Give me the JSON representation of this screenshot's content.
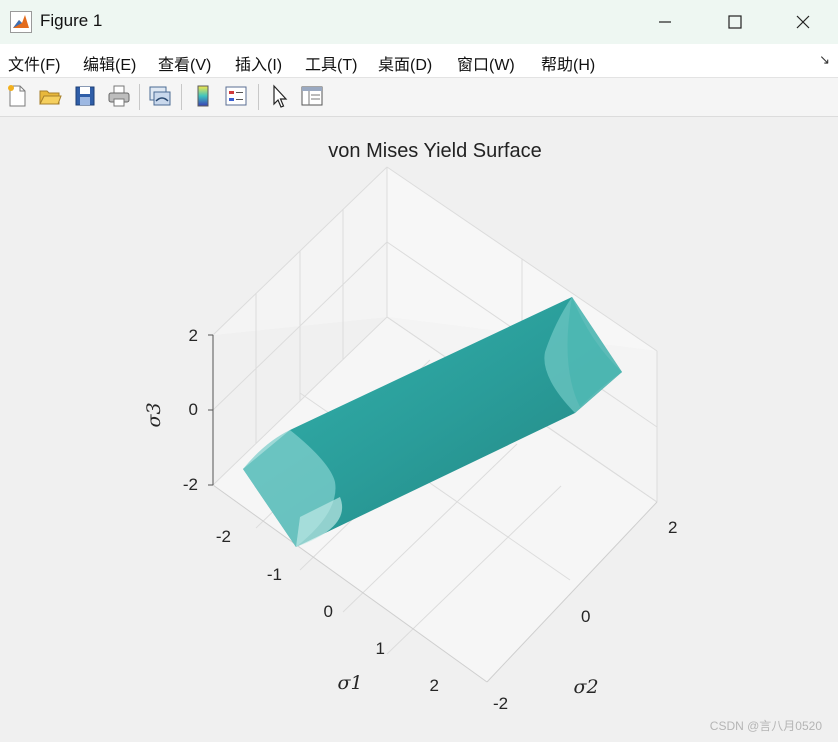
{
  "window": {
    "title": "Figure 1"
  },
  "menu": {
    "items": [
      "文件(F)",
      "编辑(E)",
      "查看(V)",
      "插入(I)",
      "工具(T)",
      "桌面(D)",
      "窗口(W)",
      "帮助(H)"
    ],
    "overflow_arrow": "↘"
  },
  "toolbar": {
    "icons": [
      "new-figure-icon",
      "open-file-icon",
      "save-icon",
      "print-icon",
      "link-plot-icon",
      "colorbar-icon",
      "legend-icon",
      "select-arrow-icon",
      "property-inspector-icon"
    ]
  },
  "chart_data": {
    "type": "surface",
    "title": "von Mises Yield Surface",
    "xlabel": "σ1",
    "ylabel": "σ2",
    "zlabel": "σ3",
    "xlim": [
      -2,
      2
    ],
    "ylim": [
      -2,
      2
    ],
    "zlim": [
      -2,
      2
    ],
    "x_ticks": [
      "-2",
      "-1",
      "0",
      "1",
      "2"
    ],
    "y_ticks": [
      "-2",
      "0",
      "2"
    ],
    "z_ticks": [
      "2",
      "0",
      "-2"
    ],
    "surface_color": "#2a9d9a",
    "grid": true,
    "description_of_surface": ""
  },
  "watermark": "CSDN @言八月0520"
}
